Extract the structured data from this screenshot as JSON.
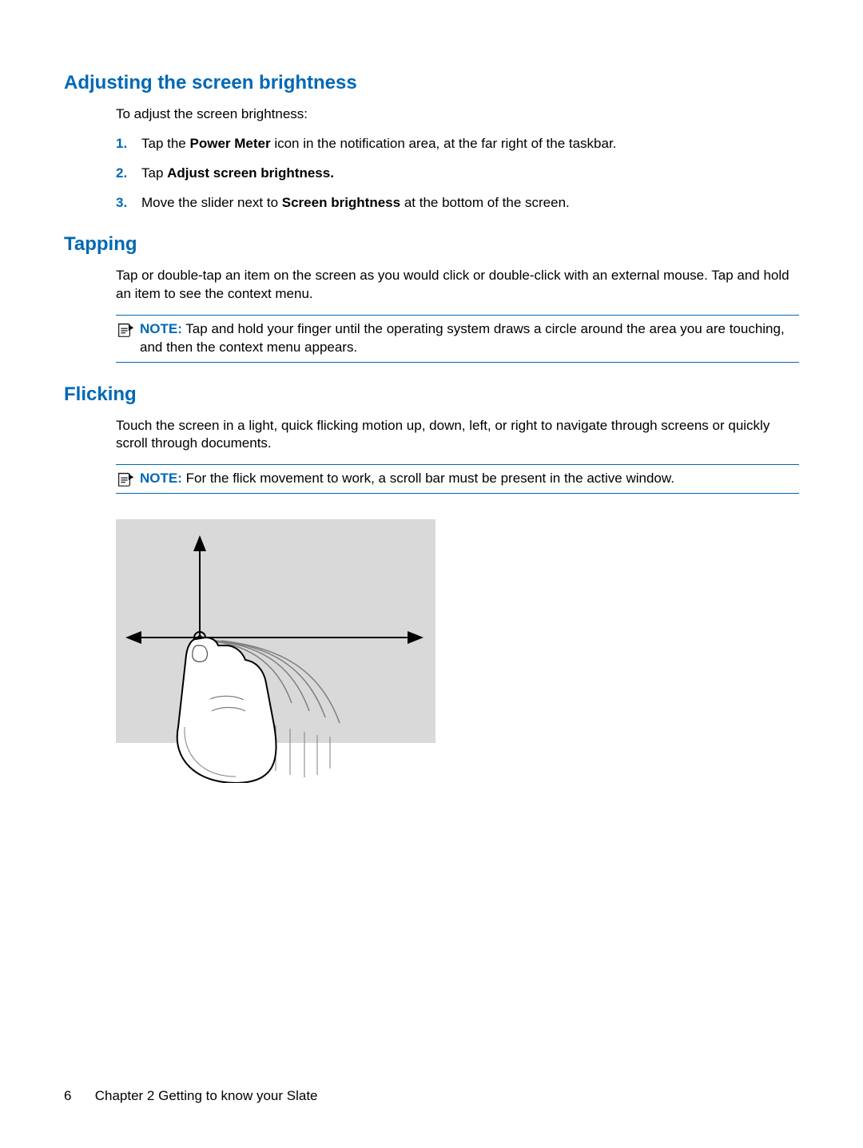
{
  "section1": {
    "heading": "Adjusting the screen brightness",
    "intro": "To adjust the screen brightness:",
    "steps": {
      "n1": "1.",
      "s1a": "Tap the ",
      "s1b": "Power Meter",
      "s1c": " icon in the notification area, at the far right of the taskbar.",
      "n2": "2.",
      "s2a": "Tap ",
      "s2b": "Adjust screen brightness",
      "s2c": ".",
      "n3": "3.",
      "s3a": "Move the slider next to ",
      "s3b": "Screen brightness",
      "s3c": " at the bottom of the screen."
    }
  },
  "section2": {
    "heading": "Tapping",
    "para": "Tap or double-tap an item on the screen as you would click or double-click with an external mouse. Tap and hold an item to see the context menu.",
    "note_label": "NOTE:",
    "note_text": "   Tap and hold your finger until the operating system draws a circle around the area you are touching, and then the context menu appears."
  },
  "section3": {
    "heading": "Flicking",
    "para": "Touch the screen in a light, quick flicking motion up, down, left, or right to navigate through screens or quickly scroll through documents.",
    "note_label": "NOTE:",
    "note_text": "   For the flick movement to work, a scroll bar must be present in the active window."
  },
  "footer": {
    "page_num": "6",
    "chapter": "Chapter 2   Getting to know your Slate"
  }
}
